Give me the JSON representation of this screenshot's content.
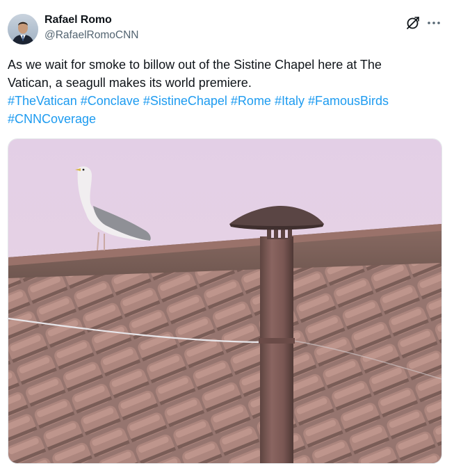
{
  "author": {
    "name": "Rafael Romo",
    "handle": "@RafaelRomoCNN"
  },
  "actions": {
    "grok_icon": "grok-icon",
    "more_icon": "more-icon",
    "more_label": "···"
  },
  "tweet": {
    "line1": "As we wait for smoke to billow out of the Sistine Chapel here at The",
    "line2": "Vatican, a seagull makes its world premiere.",
    "hashtags": [
      "#TheVatican",
      "#Conclave",
      "#SistineChapel",
      "#Rome",
      "#Italy",
      "#FamousBirds",
      "#CNNCoverage"
    ]
  },
  "colors": {
    "text": "#0f1419",
    "secondary": "#536471",
    "link": "#1d9bf0"
  }
}
